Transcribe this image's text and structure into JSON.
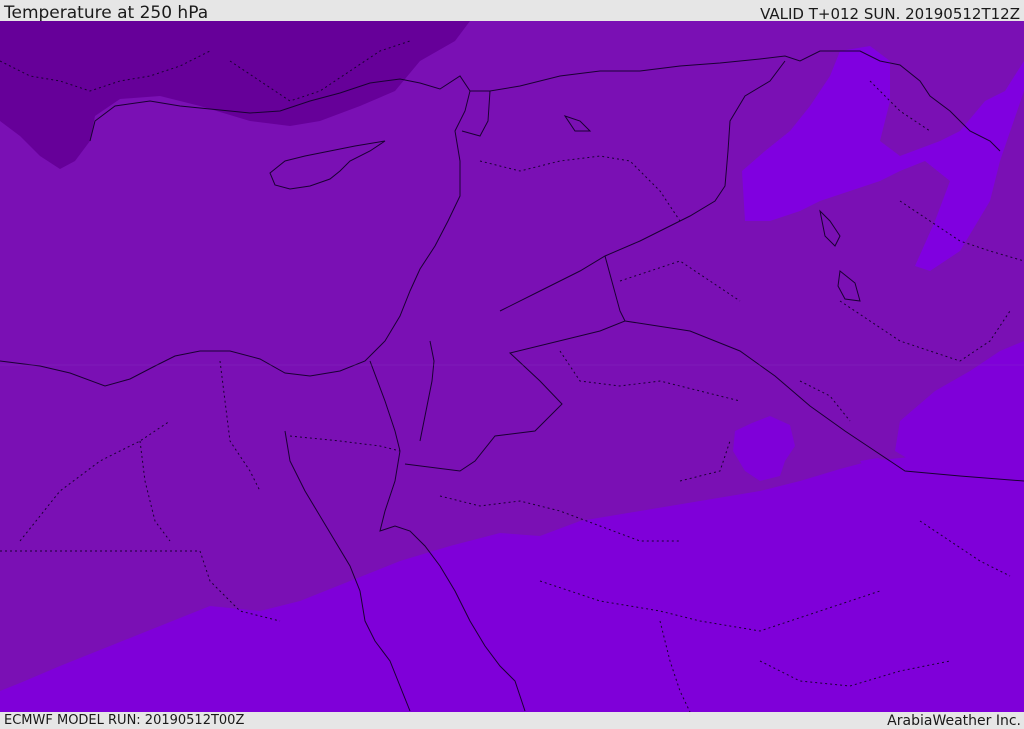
{
  "header": {
    "title": "Temperature at 250 hPa",
    "valid": "VALID T+012 SUN. 20190512T12Z"
  },
  "footer": {
    "model_run": "ECMWF MODEL RUN: 20190512T00Z",
    "brand": "ArabiaWeather Inc."
  },
  "map": {
    "colors": {
      "dark_band": "#660099",
      "mid_band": "#7a10b4",
      "bright_band": "#7f00d9",
      "light_patch": "#8a00ee",
      "border_line": "#1a0033"
    }
  }
}
